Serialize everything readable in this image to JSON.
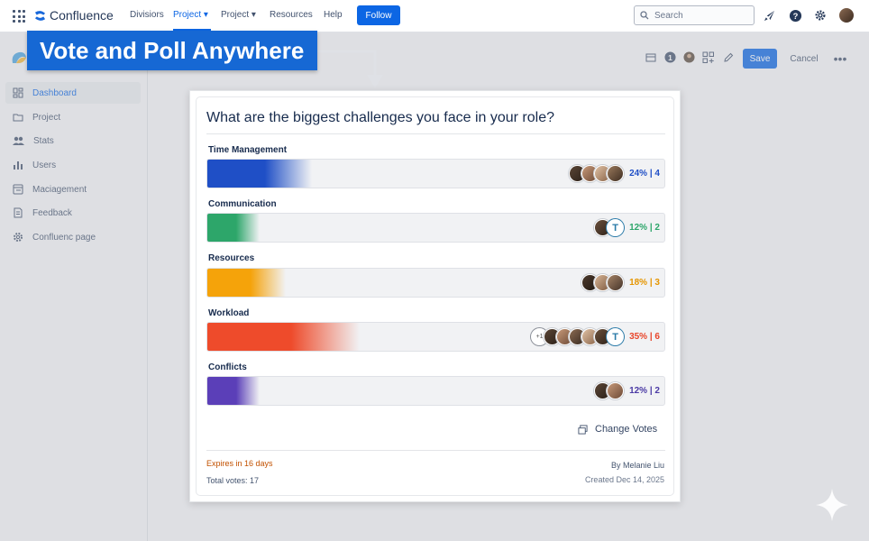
{
  "header": {
    "brand": "Confluence",
    "nav": [
      "Divisiors",
      "Project",
      "Project",
      "Resources",
      "Help"
    ],
    "follow_label": "Follow",
    "search_placeholder": "Search"
  },
  "sidebar": {
    "items": [
      {
        "label": "Dashboard",
        "icon": "dashboard-icon"
      },
      {
        "label": "Project",
        "icon": "folder-icon"
      },
      {
        "label": "Stats",
        "icon": "people-icon"
      },
      {
        "label": "Users",
        "icon": "bar-chart-icon"
      },
      {
        "label": "Maciagement",
        "icon": "database-icon"
      },
      {
        "label": "Feedback",
        "icon": "document-icon"
      },
      {
        "label": "Confluenc page",
        "icon": "gear-icon"
      }
    ]
  },
  "toolbar": {
    "save_label": "Save",
    "cancel_label": "Cancel"
  },
  "banner": {
    "text": "Vote and Poll Anywhere"
  },
  "poll": {
    "question": "What are the biggest challenges you face in your role?",
    "options": [
      {
        "label": "Time Management",
        "result": "24% | 4",
        "fill": 0.24,
        "color": "#1f4fc6"
      },
      {
        "label": "Communication",
        "result": "12% | 2",
        "fill": 0.12,
        "color": "#2da66a"
      },
      {
        "label": "Resources",
        "result": "18% | 3",
        "fill": 0.18,
        "color": "#f5a30a"
      },
      {
        "label": "Workload",
        "result": "35% | 6",
        "fill": 0.35,
        "color": "#ee4b2b"
      },
      {
        "label": "Conflicts",
        "result": "12% | 2",
        "fill": 0.12,
        "color": "#5b3fb8"
      }
    ],
    "workload_extra": "+1",
    "change_votes_label": "Change Votes",
    "expires": "Expires in 16 days",
    "total_votes": "Total votes: 17",
    "author": "By Melanie Liu",
    "created": "Created Dec 14, 2025"
  }
}
